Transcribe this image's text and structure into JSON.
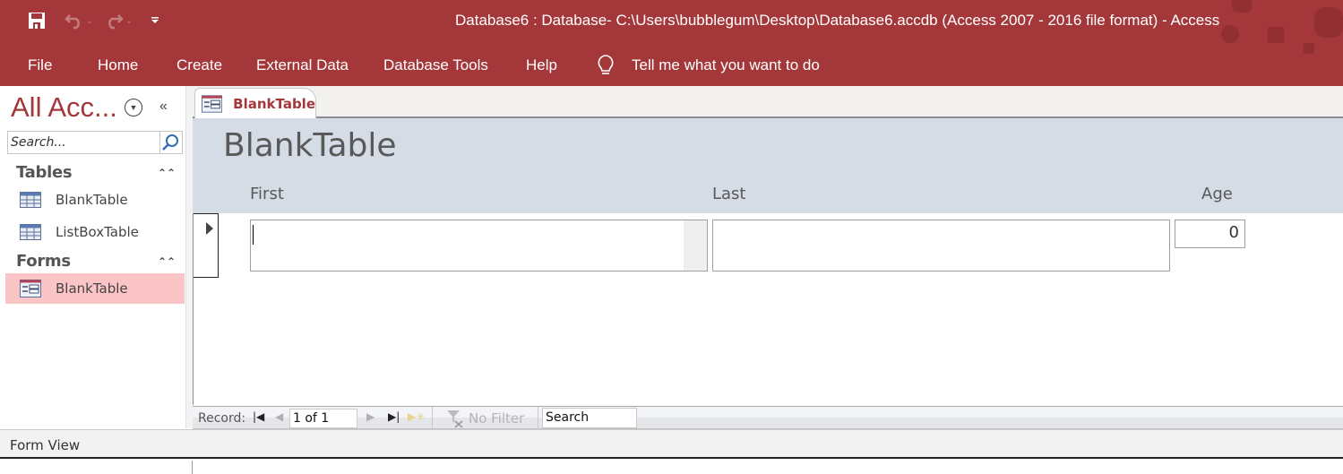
{
  "window": {
    "title": "Database6 : Database- C:\\Users\\bubblegum\\Desktop\\Database6.accdb (Access 2007 - 2016 file format)  -  Access",
    "accent_color": "#a4373a"
  },
  "quick_access": {
    "save_icon": "save-icon",
    "undo_icon": "undo-icon",
    "redo_icon": "redo-icon",
    "customize_icon": "customize-qat-icon"
  },
  "ribbon": {
    "tabs": [
      {
        "label": "File"
      },
      {
        "label": "Home"
      },
      {
        "label": "Create"
      },
      {
        "label": "External Data"
      },
      {
        "label": "Database Tools"
      },
      {
        "label": "Help"
      }
    ],
    "tell_me": "Tell me what you want to do"
  },
  "nav_pane": {
    "title": "All Acc...",
    "search_placeholder": "Search...",
    "groups": [
      {
        "label": "Tables",
        "items": [
          {
            "label": "BlankTable",
            "icon": "table-icon"
          },
          {
            "label": "ListBoxTable",
            "icon": "table-icon"
          }
        ]
      },
      {
        "label": "Forms",
        "items": [
          {
            "label": "BlankTable",
            "icon": "form-icon",
            "selected": true
          }
        ]
      }
    ]
  },
  "document": {
    "tab_label": "BlankTable",
    "form_title": "BlankTable",
    "labels": {
      "first": "First",
      "last": "Last",
      "age": "Age"
    },
    "record": {
      "first": "",
      "last": "",
      "age": "0"
    }
  },
  "record_nav": {
    "label": "Record:",
    "current": "1 of 1",
    "filter": "No Filter",
    "search": "Search"
  },
  "status": {
    "view": "Form View"
  }
}
